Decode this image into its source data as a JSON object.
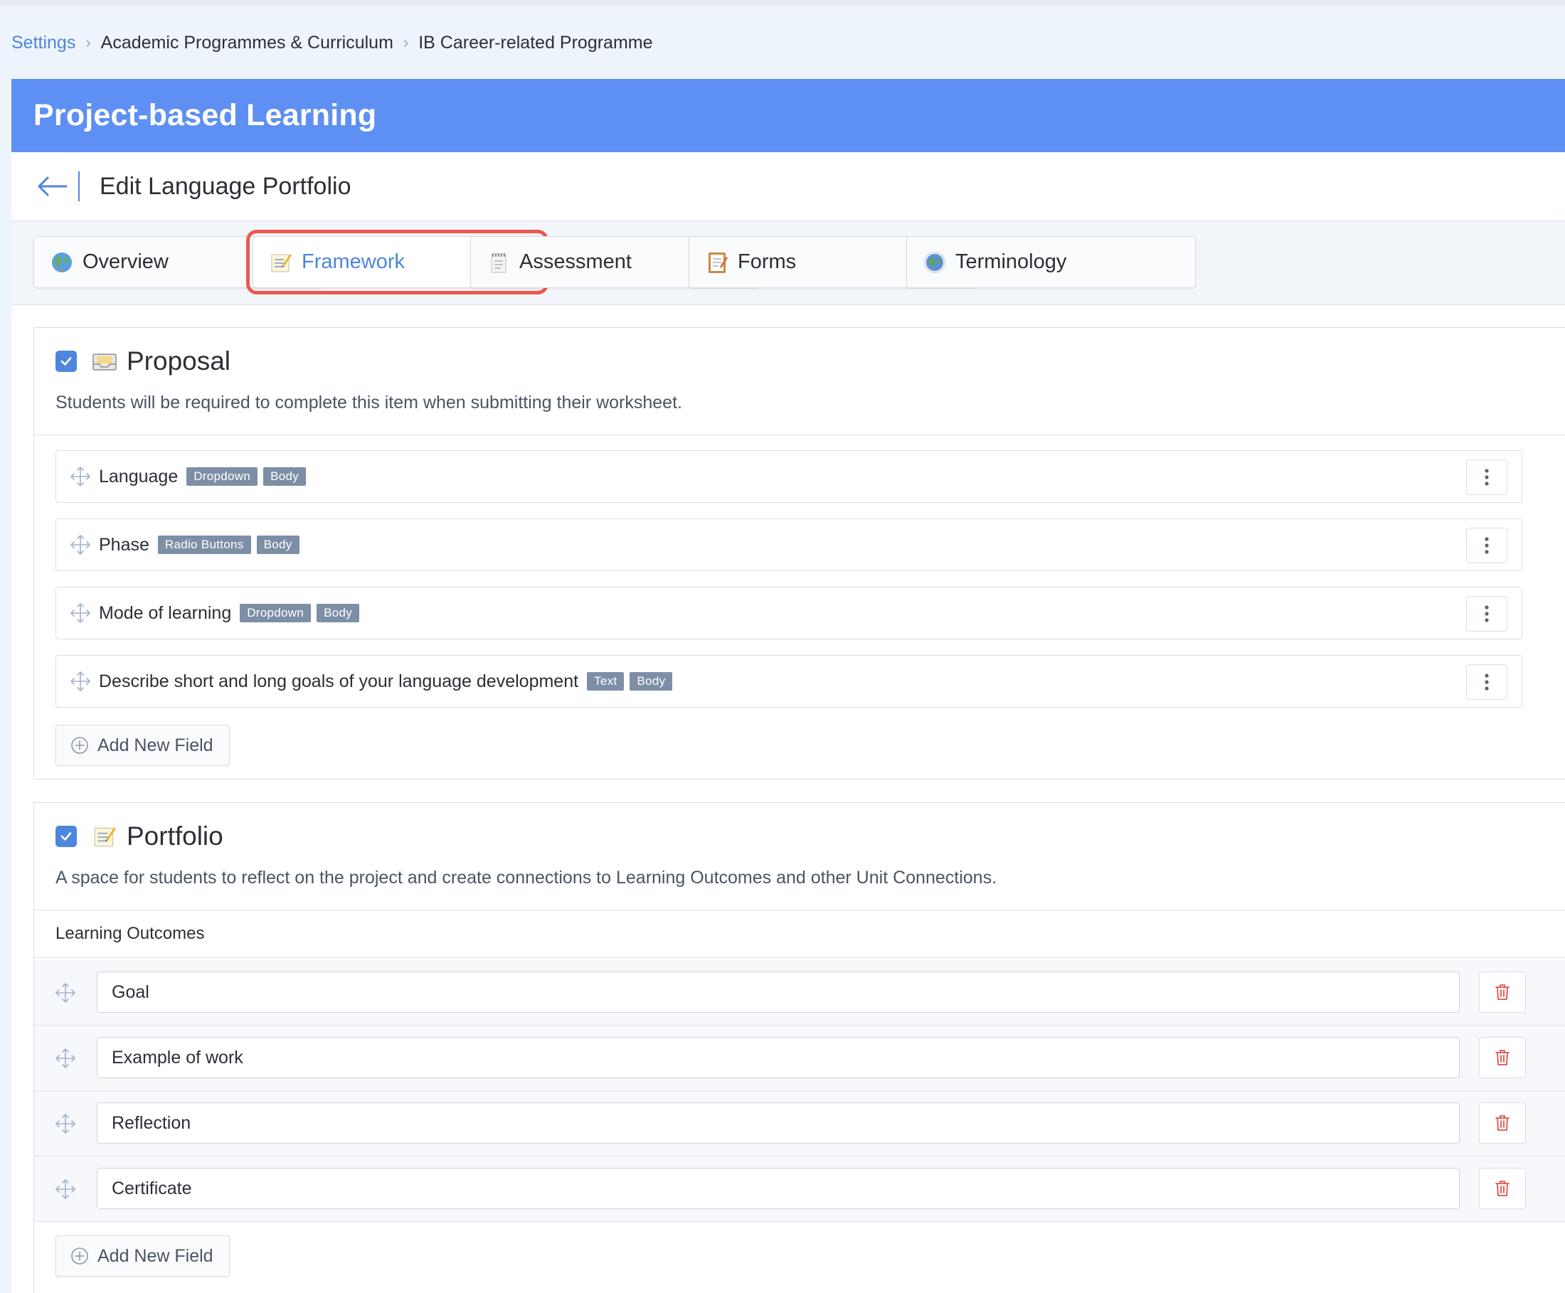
{
  "breadcrumb": {
    "root": "Settings",
    "level1": "Academic Programmes & Curriculum",
    "level2": "IB Career-related Programme"
  },
  "banner": {
    "title": "Project-based Learning"
  },
  "edit": {
    "title": "Edit Language Portfolio"
  },
  "tabs": [
    {
      "label": "Overview",
      "icon": "globe-icon"
    },
    {
      "label": "Framework",
      "icon": "memo-icon",
      "active": true
    },
    {
      "label": "Assessment",
      "icon": "notepad-icon"
    },
    {
      "label": "Forms",
      "icon": "clipboard-icon"
    },
    {
      "label": "Terminology",
      "icon": "earth-icon"
    }
  ],
  "proposal": {
    "title": "Proposal",
    "icon": "inbox-icon",
    "checked": true,
    "description": "Students will be required to complete this item when submitting their worksheet.",
    "fields": [
      {
        "name": "Language",
        "type": "Dropdown",
        "location": "Body"
      },
      {
        "name": "Phase",
        "type": "Radio Buttons",
        "location": "Body"
      },
      {
        "name": "Mode of learning",
        "type": "Dropdown",
        "location": "Body"
      },
      {
        "name": "Describe short and long goals of your language development",
        "type": "Text",
        "location": "Body"
      }
    ],
    "add_label": "Add New Field"
  },
  "portfolio": {
    "title": "Portfolio",
    "icon": "memo-icon",
    "checked": true,
    "description": "A space for students to reflect on the project and create connections to Learning Outcomes and other Unit Connections.",
    "outcomes_header": "Learning Outcomes",
    "outcomes": [
      "Goal",
      "Example of work",
      "Reflection",
      "Certificate"
    ],
    "add_label": "Add New Field"
  },
  "colors": {
    "accent": "#4d86dd",
    "banner": "#5e8ff2",
    "active_outline": "#ea5a4d",
    "badge": "#7d8ea6",
    "delete": "#e0514a"
  }
}
